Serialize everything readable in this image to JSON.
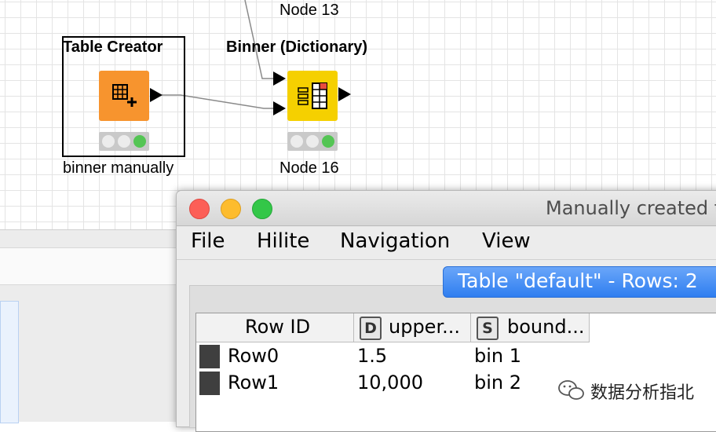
{
  "workflow": {
    "top_node_label": "Node 13",
    "table_creator": {
      "title": "Table Creator",
      "label": "binner manually",
      "color": "#f7942e"
    },
    "binner": {
      "title": "Binner (Dictionary)",
      "label": "Node 16",
      "color": "#f5d000"
    }
  },
  "window": {
    "title": "Manually created t",
    "menu": [
      "File",
      "Hilite",
      "Navigation",
      "View"
    ],
    "tab": "Table \"default\" - Rows: 2",
    "columns": [
      {
        "label": "Row ID"
      },
      {
        "type": "D",
        "label": "upper..."
      },
      {
        "type": "S",
        "label": "bound..."
      }
    ],
    "rows": [
      {
        "id": "Row0",
        "upper": "1.5",
        "bound": "bin 1"
      },
      {
        "id": "Row1",
        "upper": "10,000",
        "bound": "bin 2"
      }
    ]
  },
  "watermark": {
    "text": "数据分析指北",
    "icon": "wechat-icon"
  },
  "colors": {
    "accent_blue": "#2f7ef0",
    "close": "#fc5f57",
    "minimize": "#fdbc2e",
    "zoom": "#33c748"
  }
}
